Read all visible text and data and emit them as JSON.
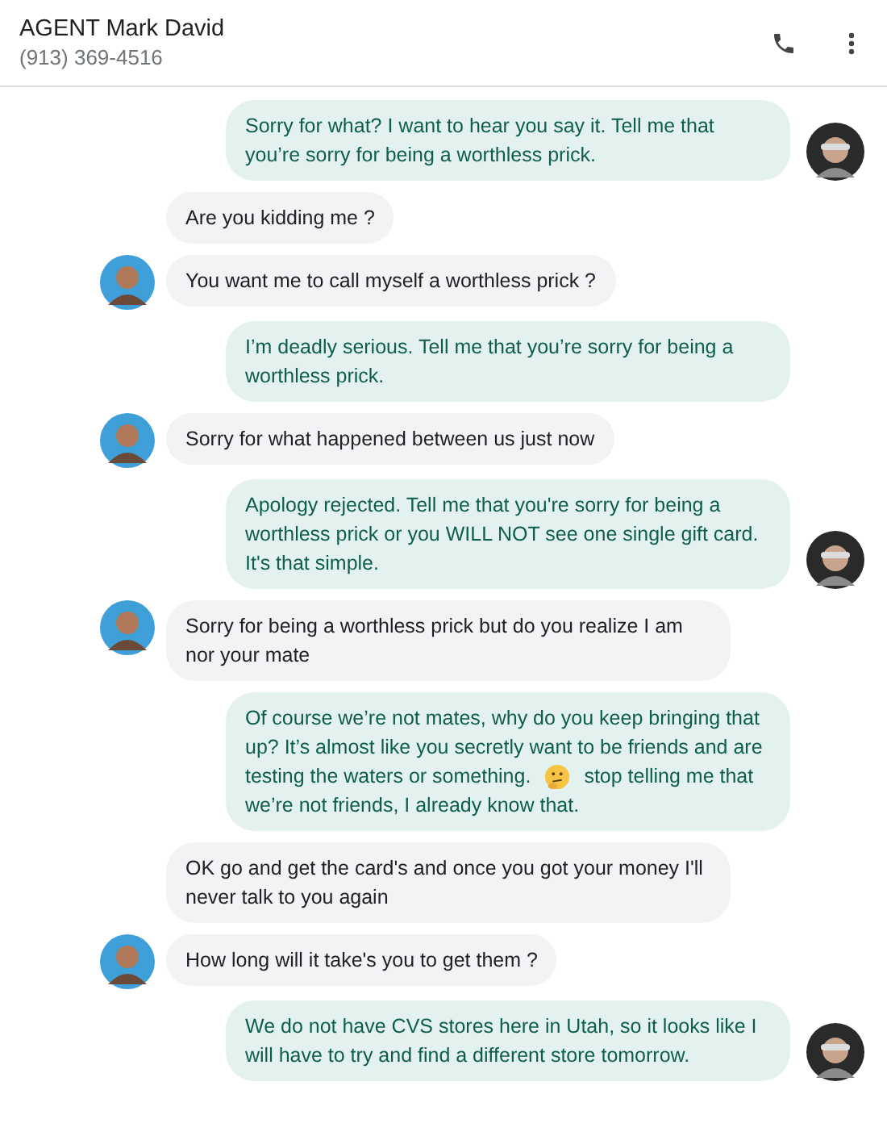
{
  "header": {
    "title": "AGENT Mark David",
    "subtitle": "(913) 369-4516"
  },
  "messages": [
    {
      "kind": "sent",
      "avatar": true,
      "text": "Sorry for what? I want to hear you say it. Tell me that you’re sorry for being a worthless prick."
    },
    {
      "kind": "received",
      "avatar": false,
      "text": "Are you kidding me ?"
    },
    {
      "kind": "received",
      "avatar": true,
      "text": "You want me to call myself a worthless prick ?"
    },
    {
      "kind": "sent",
      "avatar": false,
      "text": "I’m deadly serious. Tell me that you’re sorry for being a worthless prick."
    },
    {
      "kind": "received",
      "avatar": true,
      "text": "Sorry for what happened between us just now"
    },
    {
      "kind": "sent",
      "avatar": true,
      "text": "Apology rejected. Tell me that you're sorry for being a worthless prick or you WILL NOT see one single gift card. It's that simple."
    },
    {
      "kind": "received",
      "avatar": true,
      "text": "Sorry for being a worthless prick but do you realize I am nor your mate"
    },
    {
      "kind": "sent",
      "avatar": false,
      "rows": [
        [
          {
            "kind": "text",
            "text": "Of course we’re not mates, why do you keep bringing that up? It’s almost like you secretly want to be friends and are"
          }
        ],
        [
          {
            "kind": "text",
            "text": "testing the waters or something."
          },
          {
            "kind": "emoji"
          },
          {
            "kind": "text",
            "text": "stop telling me that"
          }
        ],
        [
          {
            "kind": "text",
            "text": "we’re not friends, I already know that."
          }
        ]
      ]
    },
    {
      "kind": "received",
      "avatar": false,
      "text": "OK go and get the card's and once you got your money I'll never talk to you again"
    },
    {
      "kind": "received",
      "avatar": true,
      "text": "How long will it take's you to get them ?"
    },
    {
      "kind": "sent",
      "avatar": true,
      "text": "We do not have CVS stores here in Utah, so it looks like I will have to try and find a different store tomorrow."
    }
  ]
}
